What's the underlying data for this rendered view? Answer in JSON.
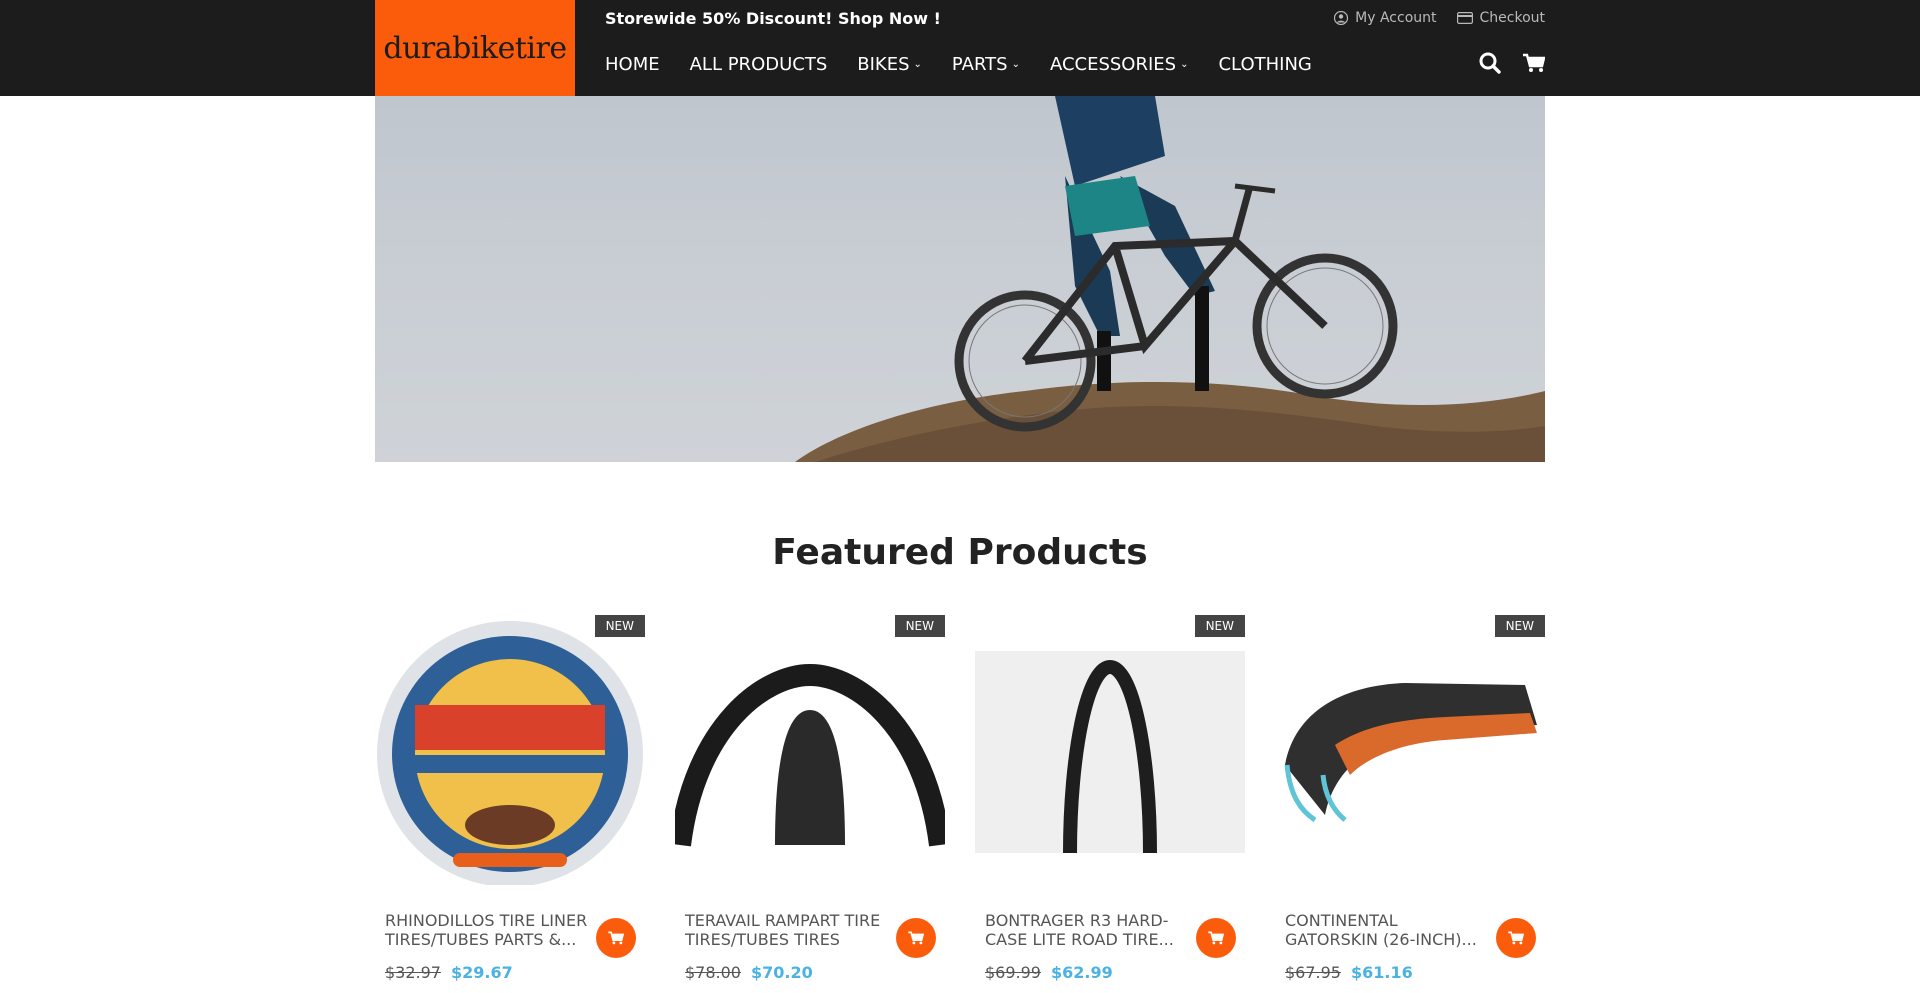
{
  "header": {
    "logo_text": "durabiketire",
    "promo": "Storewide 50% Discount! Shop Now !",
    "links": {
      "account": "My Account",
      "checkout": "Checkout"
    },
    "nav": [
      {
        "label": "HOME",
        "dropdown": false
      },
      {
        "label": "ALL PRODUCTS",
        "dropdown": false
      },
      {
        "label": "BIKES",
        "dropdown": true
      },
      {
        "label": "PARTS",
        "dropdown": true
      },
      {
        "label": "ACCESSORIES",
        "dropdown": true
      },
      {
        "label": "CLOTHING",
        "dropdown": false
      }
    ],
    "icons": [
      "search-icon",
      "cart-icon"
    ]
  },
  "section": {
    "title": "Featured Products"
  },
  "products": [
    {
      "badge": "NEW",
      "name": "RHINODILLOS TIRE LINER TIRES/TUBES PARTS &...",
      "old_price": "$32.97",
      "price": "$29.67"
    },
    {
      "badge": "NEW",
      "name": "TERAVAIL RAMPART TIRE TIRES/TUBES TIRES",
      "old_price": "$78.00",
      "price": "$70.20"
    },
    {
      "badge": "NEW",
      "name": "BONTRAGER R3 HARD-CASE LITE ROAD TIRE...",
      "old_price": "$69.99",
      "price": "$62.99"
    },
    {
      "badge": "NEW",
      "name": "CONTINENTAL GATORSKIN (26-INCH)...",
      "old_price": "$67.95",
      "price": "$61.16"
    }
  ],
  "colors": {
    "brand": "#fb5c0c",
    "header_bg": "#1c1c1c",
    "sale_price": "#4bb2e2"
  }
}
